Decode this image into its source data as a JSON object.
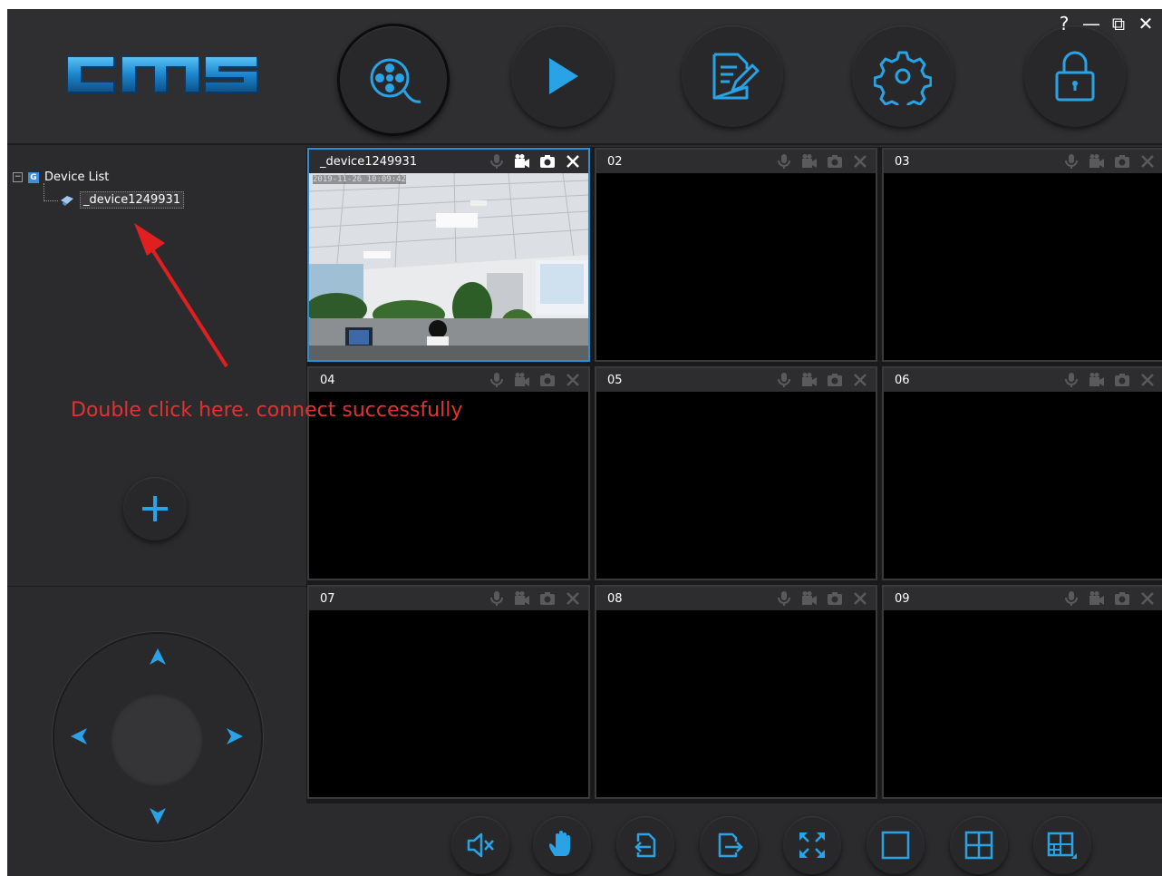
{
  "app": {
    "logo_text": "cms",
    "accent": "#29a3e6"
  },
  "toolbar": {
    "buttons": [
      {
        "icon": "film-reel-icon",
        "active": true
      },
      {
        "icon": "play-icon"
      },
      {
        "icon": "edit-document-icon"
      },
      {
        "icon": "settings-gear-icon"
      },
      {
        "icon": "lock-icon"
      }
    ]
  },
  "window_controls": {
    "help": "?",
    "minimize": "—",
    "restore": "⧉",
    "close": "✕"
  },
  "device_tree": {
    "root_label": "Device List",
    "root_badge": "G",
    "expander": "⊟",
    "devices": [
      {
        "label": "_device1249931"
      }
    ]
  },
  "annotation": {
    "text": "Double click here. connect successfully",
    "color": "#e23232"
  },
  "cells": [
    {
      "title": "_device1249931",
      "active": true,
      "osd": "2019-11-26  10:09:42"
    },
    {
      "title": "02"
    },
    {
      "title": "03"
    },
    {
      "title": "04"
    },
    {
      "title": "05"
    },
    {
      "title": "06"
    },
    {
      "title": "07"
    },
    {
      "title": "08"
    },
    {
      "title": "09"
    }
  ],
  "bottom_toolbar": [
    {
      "icon": "mute-icon"
    },
    {
      "icon": "hand-icon"
    },
    {
      "icon": "previous-page-icon"
    },
    {
      "icon": "next-page-icon"
    },
    {
      "icon": "fullscreen-icon"
    },
    {
      "icon": "layout-1-icon"
    },
    {
      "icon": "layout-4-icon"
    },
    {
      "icon": "layout-custom-icon"
    }
  ]
}
